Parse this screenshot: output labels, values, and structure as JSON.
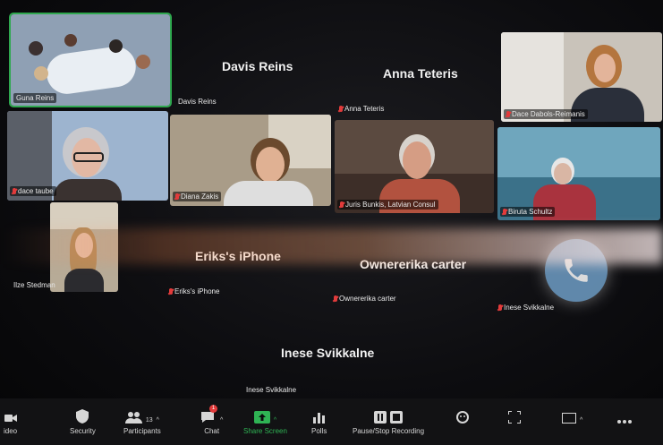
{
  "participants": {
    "guna": "Guna Reins",
    "davis_center": "Davis Reins",
    "davis_label": "Davis Reins",
    "anna_center": "Anna Teteris",
    "anna_label": "Anna Teteris",
    "dace_dabols": "Dace Dabols-Reimanis",
    "dace_taube": "dace taube",
    "diana": "Diana Zakis",
    "juris": "Juris Bunkis, Latvian Consul",
    "biruta": "Biruta Schultz",
    "ilze": "Ilze Stedman",
    "eriks_center": "Eriks's iPhone",
    "eriks_label": "Eriks's iPhone",
    "owner_center": "Ownererika carter",
    "owner_label": "Ownererika carter",
    "inese_center": "Inese Svikkalne",
    "inese_label": "Inese Svikkalne",
    "inese_side_label": "Inese Svikkalne"
  },
  "toolbar": {
    "video": "ideo",
    "security": "Security",
    "participants": "Participants",
    "participants_count": "13",
    "chat": "Chat",
    "chat_badge": "1",
    "share": "Share Screen",
    "polls": "Polls",
    "recording": "Pause/Stop Recording"
  },
  "colors": {
    "active_speaker": "#2fa84f",
    "muted": "#e23b3b",
    "call_button": "#6f9ec6",
    "share_green": "#2fb354"
  }
}
